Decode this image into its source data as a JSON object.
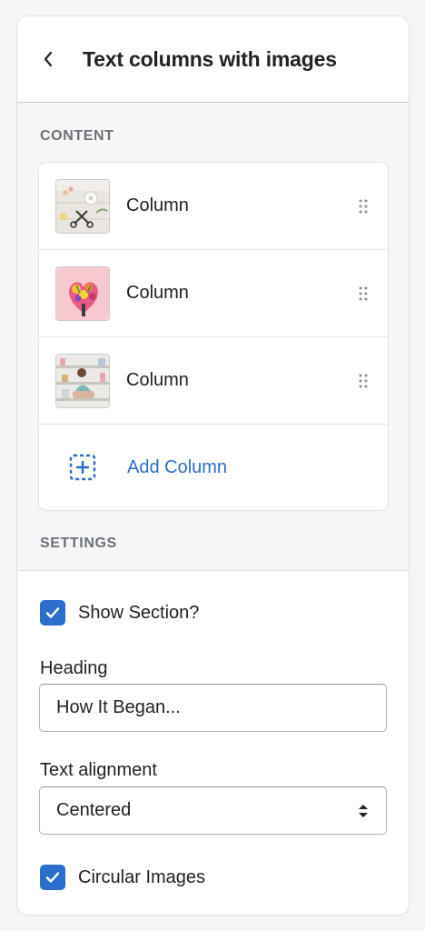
{
  "header": {
    "back_icon": "chevron-left-icon",
    "title": "Text columns with images"
  },
  "content": {
    "section_label": "CONTENT",
    "columns": [
      {
        "label": "Column",
        "thumbnail": "flowers-scissors-image"
      },
      {
        "label": "Column",
        "thumbnail": "flower-heart-image"
      },
      {
        "label": "Column",
        "thumbnail": "woman-shelves-image"
      }
    ],
    "add_label": "Add Column",
    "add_icon": "add-dashed-square-icon"
  },
  "settings": {
    "section_label": "SETTINGS",
    "show_section": {
      "label": "Show Section?",
      "checked": true
    },
    "heading": {
      "label": "Heading",
      "value": "How It Began..."
    },
    "text_alignment": {
      "label": "Text alignment",
      "value": "Centered"
    },
    "circular_images": {
      "label": "Circular Images",
      "checked": true
    }
  },
  "colors": {
    "accent": "#2c6ecb",
    "text": "#202223",
    "muted": "#6d7175",
    "background": "#f4f6f8"
  }
}
